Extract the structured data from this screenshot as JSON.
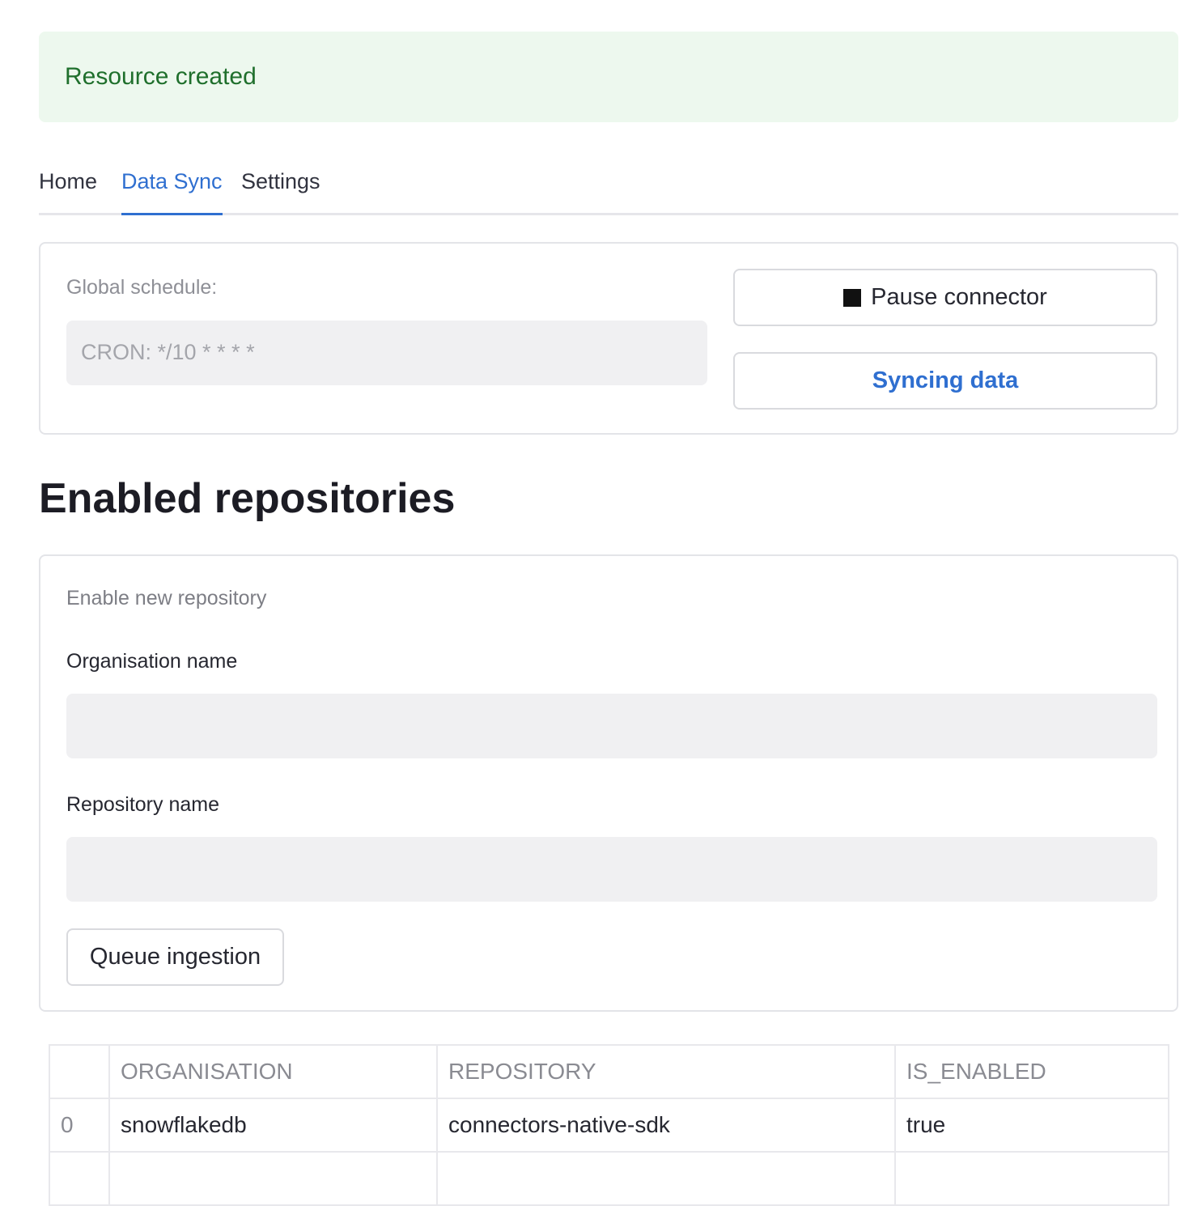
{
  "alert": {
    "message": "Resource created"
  },
  "tabs": [
    {
      "label": "Home",
      "active": false
    },
    {
      "label": "Data Sync",
      "active": true
    },
    {
      "label": "Settings",
      "active": false
    }
  ],
  "schedule": {
    "label": "Global schedule:",
    "value": "CRON: */10 * * * *"
  },
  "actions": {
    "pause_label": "Pause connector",
    "sync_label": "Syncing data"
  },
  "section": {
    "title": "Enabled repositories"
  },
  "form": {
    "title": "Enable new repository",
    "org_label": "Organisation name",
    "org_value": "",
    "repo_label": "Repository name",
    "repo_value": "",
    "submit_label": "Queue ingestion"
  },
  "table": {
    "headers": [
      "",
      "ORGANISATION",
      "REPOSITORY",
      "IS_ENABLED"
    ],
    "rows": [
      [
        "0",
        "snowflakedb",
        "connectors-native-sdk",
        "true"
      ]
    ]
  },
  "colors": {
    "accent": "#2f6fd0",
    "success_bg": "#edf8ee",
    "success_text": "#1f6f2c"
  },
  "icons": {
    "pause": "stop-square-icon"
  }
}
